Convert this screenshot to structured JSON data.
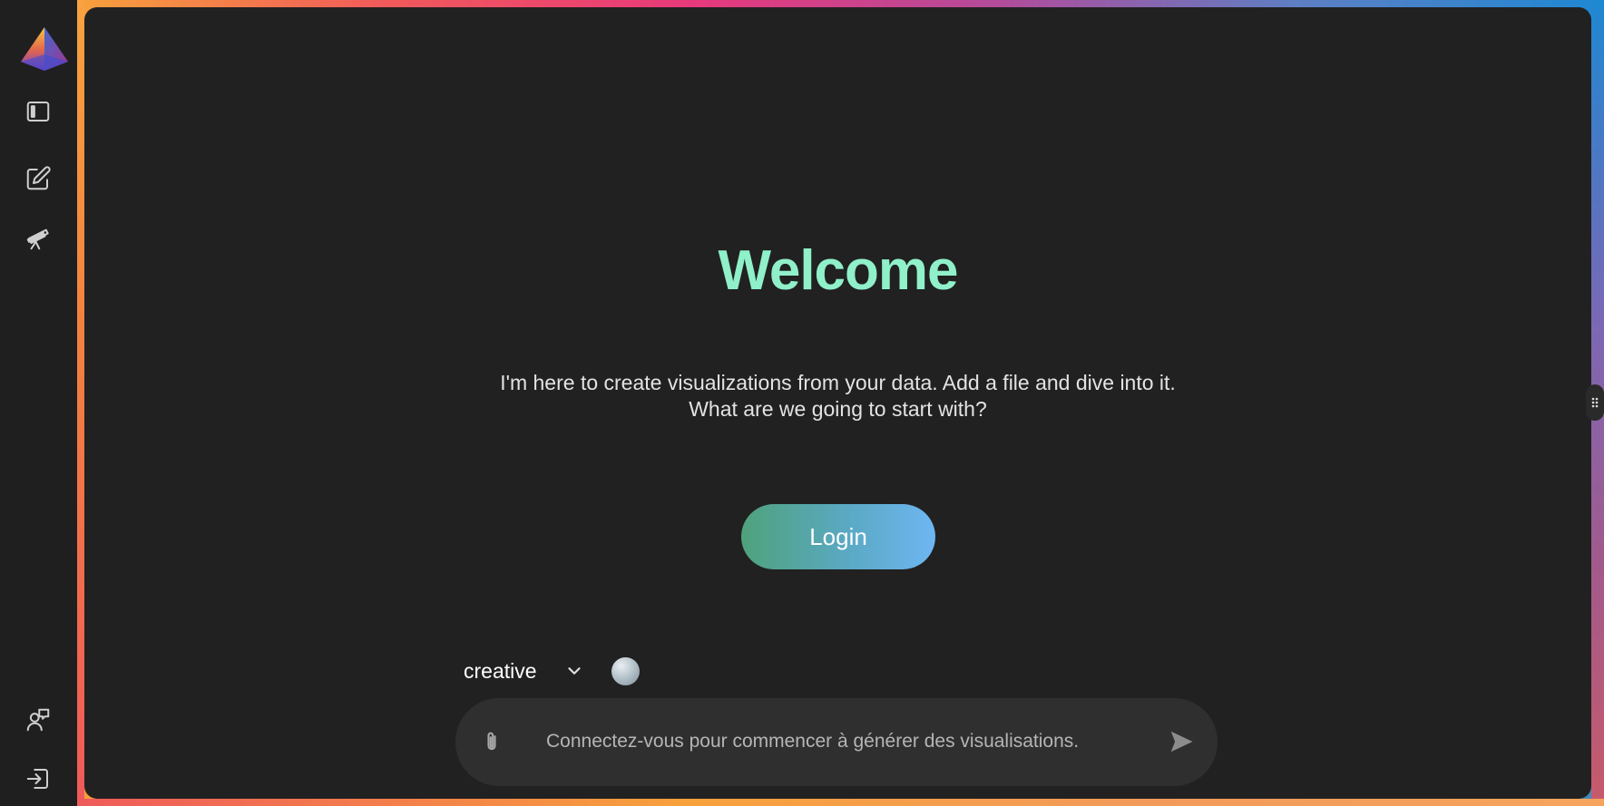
{
  "sidebar": {
    "icons": [
      "logo-pyramid",
      "panel-toggle-icon",
      "edit-icon",
      "telescope-icon",
      "feedback-icon",
      "login-icon"
    ]
  },
  "main": {
    "title": "Welcome",
    "intro_line1": "I'm here to create visualizations from your data. Add a file and dive into it.",
    "intro_line2": "What are we going to start with?",
    "login_label": "Login"
  },
  "mode": {
    "selected": "creative"
  },
  "composer": {
    "placeholder": "Connectez-vous pour commencer à générer des visualisations."
  },
  "colors": {
    "accent_title": "#8ff0c9",
    "login_gradient_start": "#4fa27b",
    "login_gradient_end": "#6eb6f2",
    "background": "#212121"
  }
}
